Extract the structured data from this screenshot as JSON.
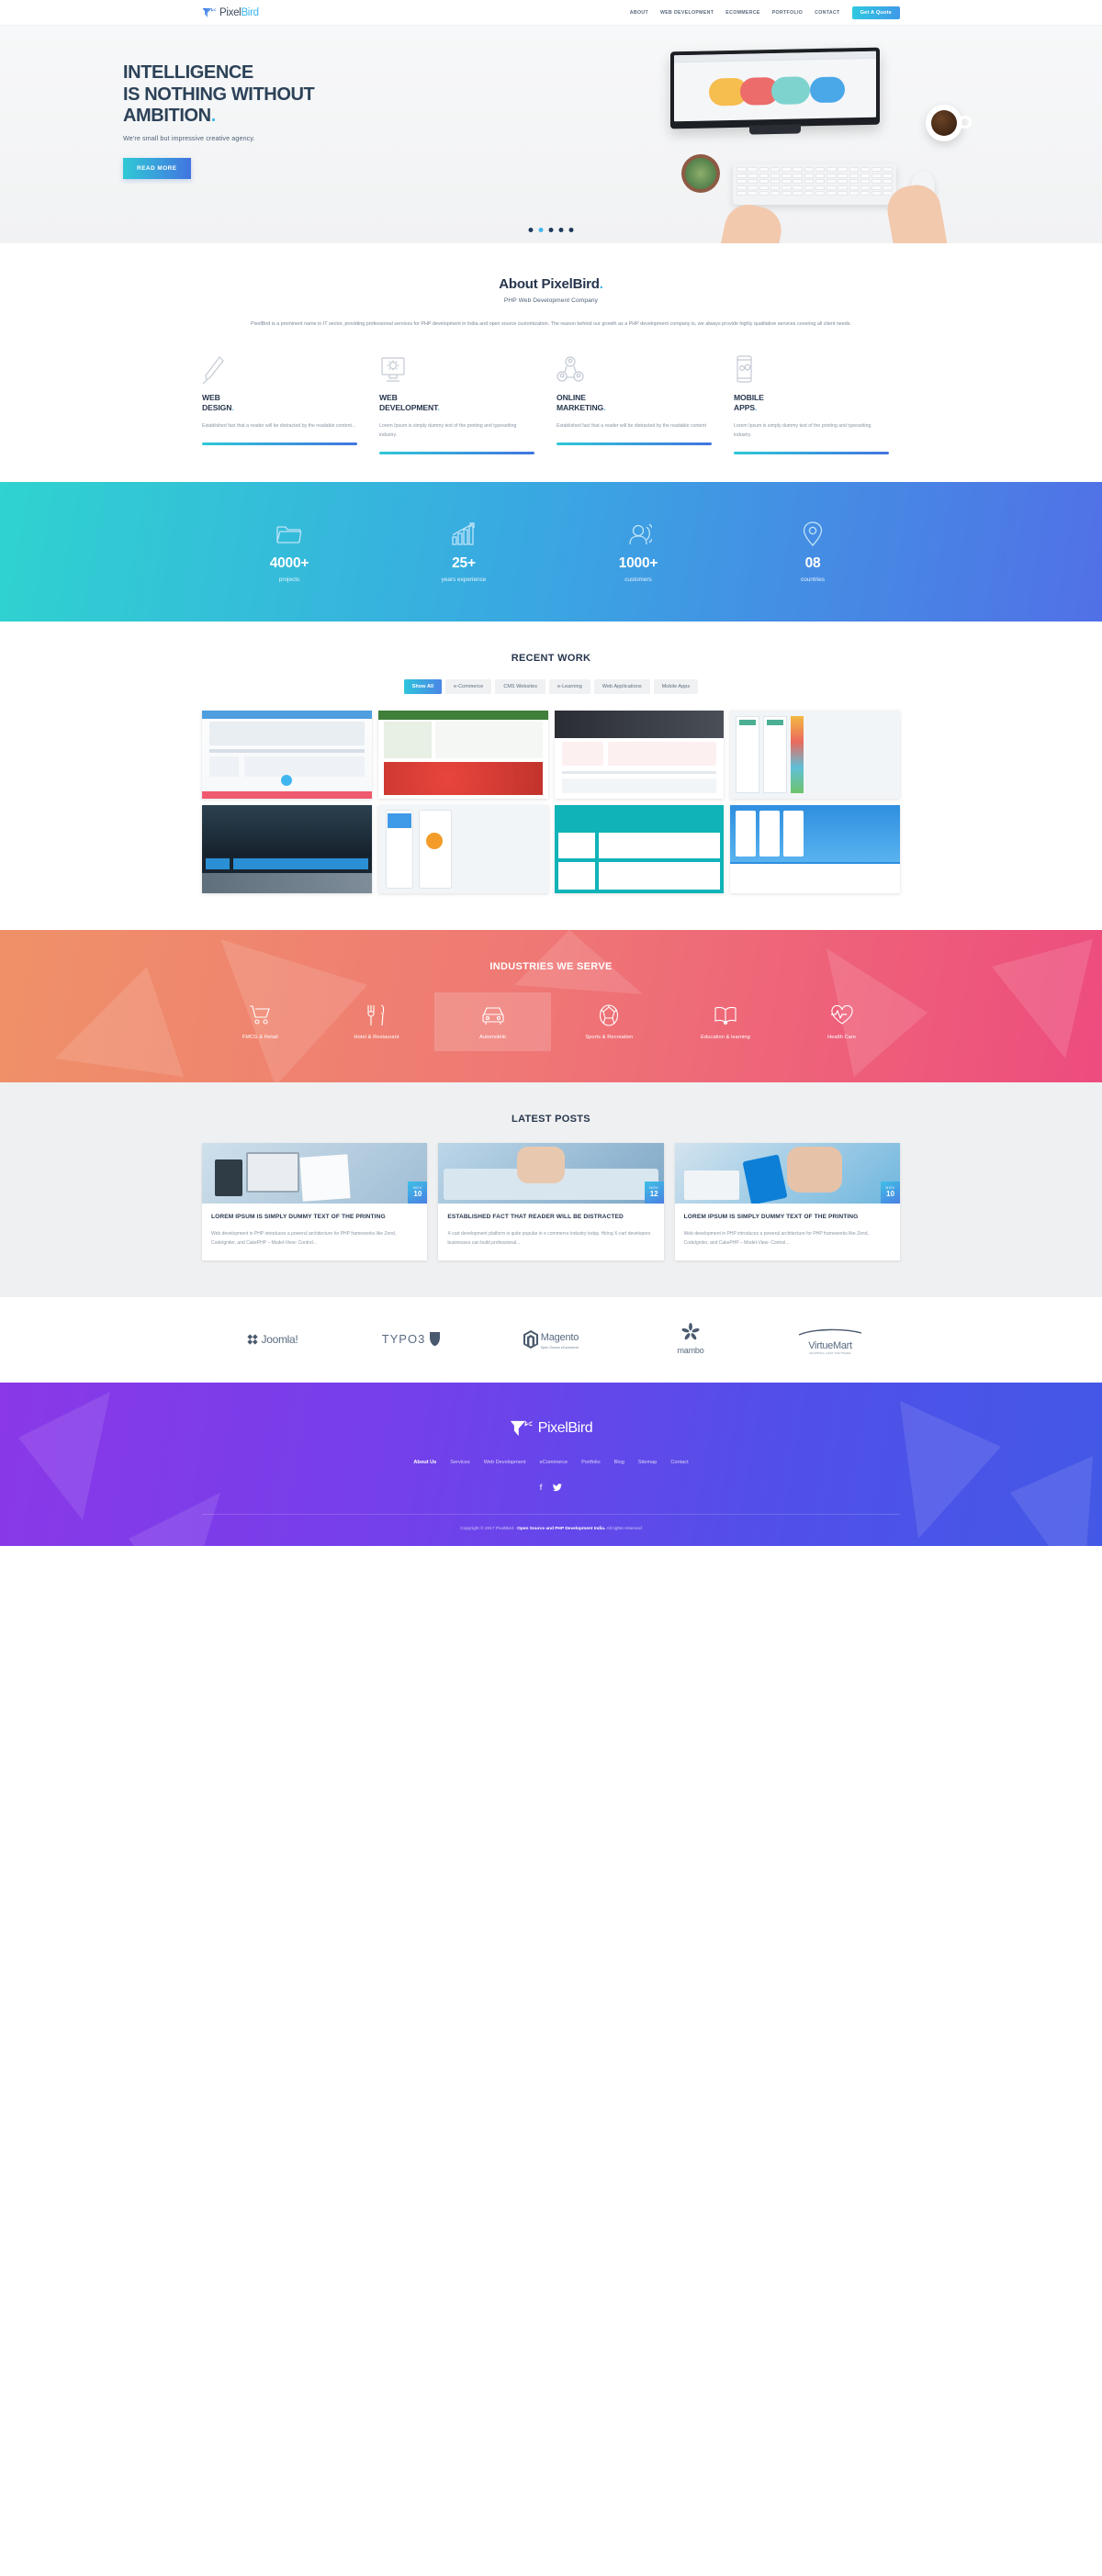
{
  "brand": {
    "name_first": "Pixel",
    "name_second": "Bird",
    "logo_icon": "bird-logo-icon"
  },
  "header": {
    "nav": [
      {
        "label": "ABOUT",
        "name": "nav-about"
      },
      {
        "label": "WEB DEVELOPMENT",
        "name": "nav-web-development"
      },
      {
        "label": "ECOMMERCE",
        "name": "nav-ecommerce"
      },
      {
        "label": "PORTFOLIO",
        "name": "nav-portfolio"
      },
      {
        "label": "CONTACT",
        "name": "nav-contact"
      }
    ],
    "cta_label": "Get A Quote"
  },
  "hero": {
    "line1": "INTELLIGENCE",
    "line2": "IS NOTHING WITHOUT",
    "line3": "AMBITION",
    "period": ".",
    "subtitle": "We're small but impressive creative agency.",
    "button": "READ MORE",
    "slides": 5,
    "active_slide": 2
  },
  "about": {
    "title_plain": "About ",
    "title_brand": "PixelBird",
    "title_dot": ".",
    "subtitle": "PHP Web Development Company",
    "body": "PixelBird is a prominent name in IT sector, providing professional services for PHP development in India and open source customization. The reason behind our growth as a PHP development company is, we always provide highly qualitative services covering all client needs.",
    "services": [
      {
        "icon": "paintbrush-icon",
        "title_l1": "WEB",
        "title_l2": "DESIGN",
        "dot": ".",
        "text": "Established fact that a reader will be distracted by the readable content..."
      },
      {
        "icon": "monitor-gear-icon",
        "title_l1": "WEB",
        "title_l2": "DEVELOPMENT",
        "dot": ".",
        "text": "Lorem Ipsum is simply dummy text of the printing and typesetting industry."
      },
      {
        "icon": "people-network-icon",
        "title_l1": "ONLINE",
        "title_l2": "MARKETING",
        "dot": ".",
        "text": "Established fact that a reader will be distracted by the readable content"
      },
      {
        "icon": "mobile-gear-icon",
        "title_l1": "MOBILE",
        "title_l2": "APPS",
        "dot": ".",
        "text": "Lorem Ipsum is simply dummy text of the printing and typesetting industry."
      }
    ]
  },
  "stats": {
    "items": [
      {
        "icon": "folder-icon",
        "value": "4000+",
        "label": "projects"
      },
      {
        "icon": "bar-chart-arrow-icon",
        "value": "25+",
        "label": "years experience"
      },
      {
        "icon": "user-group-icon",
        "value": "1000+",
        "label": "customers"
      },
      {
        "icon": "map-pin-icon",
        "value": "08",
        "label": "countries"
      }
    ],
    "gradient_from": "#2fd3d0",
    "gradient_to": "#5170e6"
  },
  "work": {
    "title": "RECENT WORK",
    "filters": [
      {
        "label": "Show All",
        "active": true
      },
      {
        "label": "e-Commerce",
        "active": false
      },
      {
        "label": "CMS Websites",
        "active": false
      },
      {
        "label": "e-Learning",
        "active": false
      },
      {
        "label": "Web Applications",
        "active": false
      },
      {
        "label": "Mobile Apps",
        "active": false
      }
    ],
    "items": [
      {
        "name": "portfolio-item-1"
      },
      {
        "name": "portfolio-item-2"
      },
      {
        "name": "portfolio-item-3"
      },
      {
        "name": "portfolio-item-4"
      },
      {
        "name": "portfolio-item-5"
      },
      {
        "name": "portfolio-item-6"
      },
      {
        "name": "portfolio-item-7"
      },
      {
        "name": "portfolio-item-8"
      }
    ]
  },
  "industries": {
    "title": "INDUSTRIES WE SERVE",
    "items": [
      {
        "icon": "shopping-cart-icon",
        "label": "FMCG & Retail",
        "active": false
      },
      {
        "icon": "cutlery-icon",
        "label": "Hotel & Restaurant",
        "active": false
      },
      {
        "icon": "car-icon",
        "label": "Automobile",
        "active": true
      },
      {
        "icon": "soccer-ball-icon",
        "label": "Sports & Recreation",
        "active": false
      },
      {
        "icon": "open-book-icon",
        "label": "Education & learning",
        "active": false
      },
      {
        "icon": "heart-pulse-icon",
        "label": "Health Care",
        "active": false
      }
    ],
    "gradient_from": "#ef9168",
    "gradient_to": "#ed4c7e"
  },
  "posts": {
    "title": "LATEST POSTS",
    "items": [
      {
        "month": "NOV",
        "day": "10",
        "title": "LOREM IPSUM IS SIMPLY DUMMY TEXT OF THE PRINTING",
        "excerpt": "Web development in PHP introduces a powerul architecture for PHP frameworks like Zend, CodeIgniter, and CakePHP – Model-View- Control..."
      },
      {
        "month": "NOV",
        "day": "12",
        "title": "ESTABLISHED FACT THAT READER WILL BE DISTRACTED",
        "excerpt": "X-cart development platform is quite popular in e commerce industry today. Hiring X-cart developers businesses can build professional..."
      },
      {
        "month": "NOV",
        "day": "10",
        "title": "LOREM IPSUM IS SIMPLY DUMMY TEXT OF THE PRINTING",
        "excerpt": "Web development in PHP introduces a powerul architecture for PHP frameworks like Zend, CodeIgniter, and CakePHP – Model-View- Control..."
      }
    ]
  },
  "partners": [
    {
      "name": "joomla-logo",
      "text": "Joomla!"
    },
    {
      "name": "typo3-logo",
      "text": "TYPO3"
    },
    {
      "name": "magento-logo",
      "text": "Magento",
      "sub": "Open Source eCommerce"
    },
    {
      "name": "mambo-logo",
      "text": "mambo"
    },
    {
      "name": "virtuemart-logo",
      "text": "VirtueMart",
      "sub": "SHOPPING CART SOFTWARE"
    }
  ],
  "footer": {
    "nav": [
      {
        "label": "About Us",
        "active": true
      },
      {
        "label": "Services",
        "active": false
      },
      {
        "label": "Web Development",
        "active": false
      },
      {
        "label": "eCommerce",
        "active": false
      },
      {
        "label": "Portfolio",
        "active": false
      },
      {
        "label": "Blog",
        "active": false
      },
      {
        "label": "Sitemap",
        "active": false
      },
      {
        "label": "Contact",
        "active": false
      }
    ],
    "social": [
      {
        "icon": "facebook-icon",
        "glyph": "f"
      },
      {
        "icon": "twitter-icon",
        "glyph": "ᵛ"
      }
    ],
    "copyright_pre": "Copyright © 2017 PixelBird - ",
    "copyright_bold": "Open Source and PHP Development India.",
    "copyright_post": " All rights reserved",
    "gradient_from": "#8a38e8",
    "gradient_to": "#4358e6"
  }
}
